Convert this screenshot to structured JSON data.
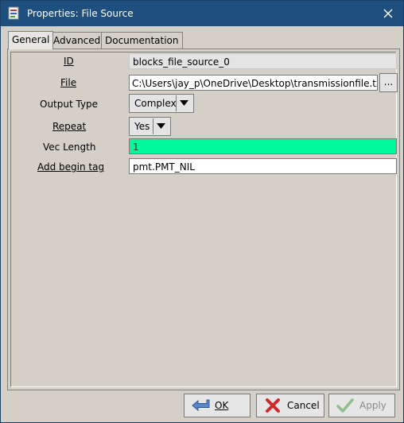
{
  "window": {
    "title": "Properties: File Source"
  },
  "tabs": [
    {
      "label": "General"
    },
    {
      "label": "Advanced"
    },
    {
      "label": "Documentation"
    }
  ],
  "fields": {
    "id": {
      "label": "ID",
      "value": "blocks_file_source_0"
    },
    "file": {
      "label": "File",
      "value": "C:\\Users\\jay_p\\OneDrive\\Desktop\\transmissionfile.txt",
      "browse": "..."
    },
    "output_type": {
      "label": "Output Type",
      "value": "Complex"
    },
    "repeat": {
      "label": "Repeat",
      "value": "Yes"
    },
    "vec_length": {
      "label": "Vec Length",
      "value": "1"
    },
    "add_begin_tag": {
      "label": "Add begin tag",
      "value": "pmt.PMT_NIL"
    }
  },
  "buttons": {
    "ok": "OK",
    "cancel": "Cancel",
    "apply": "Apply"
  },
  "icons": [
    "window-icon",
    "close-icon",
    "ok-icon",
    "cancel-icon",
    "apply-icon",
    "chevron-down-icon"
  ],
  "colors": {
    "titlebar": "#1f4f7e",
    "vec_length_bg": "#00fa9a"
  }
}
